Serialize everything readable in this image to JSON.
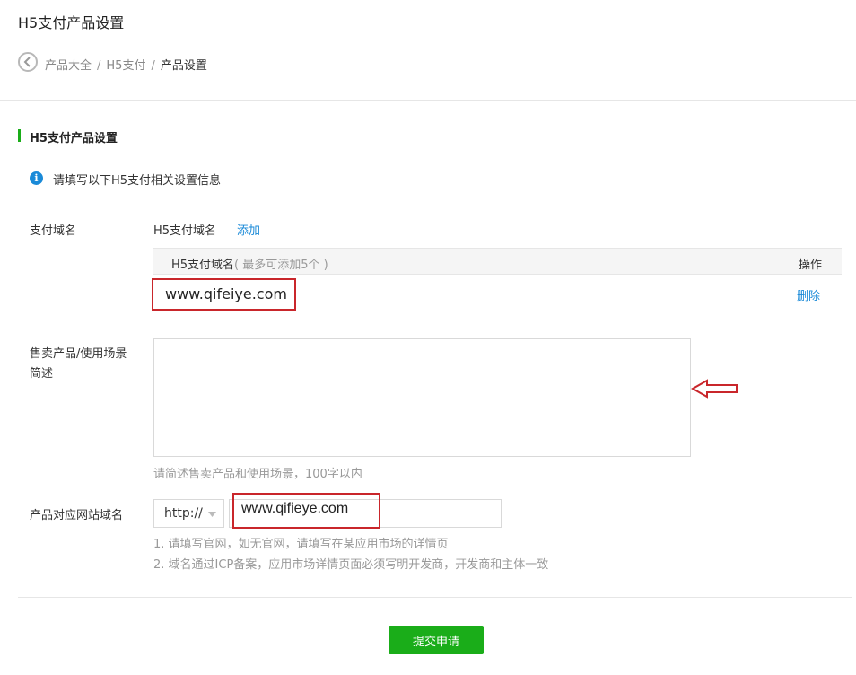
{
  "page": {
    "title": "H5支付产品设置"
  },
  "breadcrumb": {
    "items": [
      "产品大全",
      "H5支付"
    ],
    "separator": "/",
    "current": "产品设置"
  },
  "section": {
    "title": "H5支付产品设置",
    "info_text": "请填写以下H5支付相关设置信息"
  },
  "pay_domain": {
    "label": "支付域名",
    "head_label": "H5支付域名",
    "add_label": "添加",
    "table": {
      "col_name": "H5支付域名",
      "col_name_hint": "( 最多可添加5个 )",
      "col_op": "操作",
      "rows": [
        {
          "domain": "www.qifeiye.com",
          "action": "删除"
        }
      ]
    }
  },
  "description": {
    "label_line1": "售卖产品/使用场景",
    "label_line2": "简述",
    "value": "",
    "hint": "请简述售卖产品和使用场景，100字以内"
  },
  "website": {
    "label": "产品对应网站域名",
    "protocol": "http://",
    "value": "www.qifieye.com",
    "hints": [
      "1. 请填写官网，如无官网，请填写在某应用市场的详情页",
      "2. 域名通过ICP备案，应用市场详情页面必须写明开发商，开发商和主体一致"
    ]
  },
  "submit": {
    "label": "提交申请"
  },
  "colors": {
    "accent_green": "#1aad19",
    "link_blue": "#1a8ad8",
    "annotation_red": "#c9262b"
  },
  "icons": {
    "back": "chevron-left-circle-icon",
    "info": "info-circle-icon",
    "caret": "caret-down-icon",
    "annotation": "left-arrow-outline-icon"
  }
}
